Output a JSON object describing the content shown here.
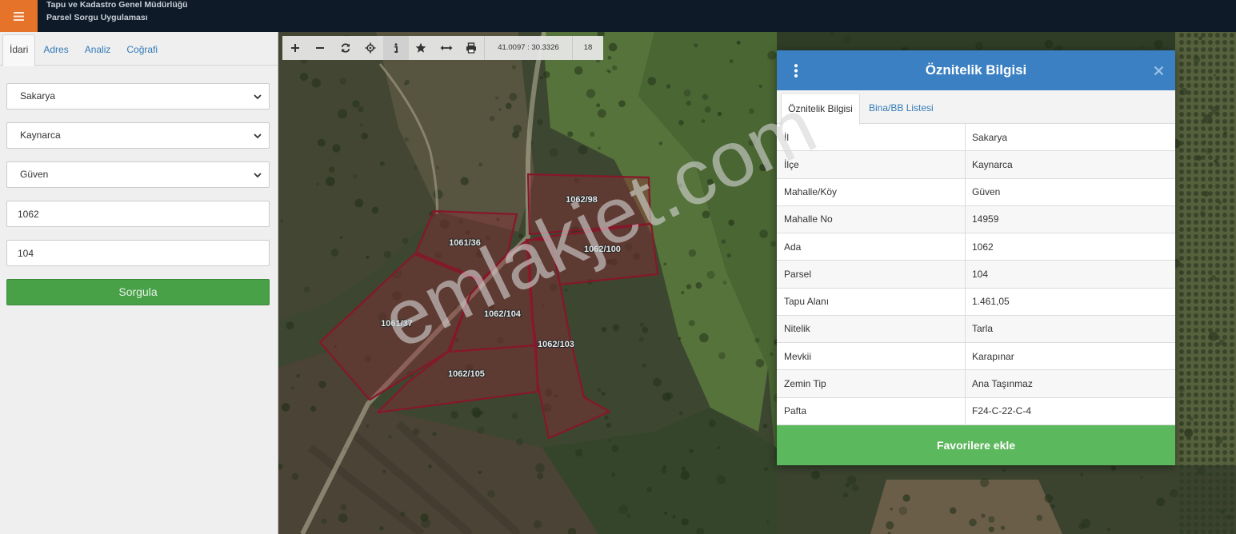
{
  "header": {
    "title_line1": "Tapu ve Kadastro Genel Müdürlüğü",
    "title_line2": "Parsel Sorgu Uygulaması",
    "menu_icon": "hamburger-icon"
  },
  "colors": {
    "header_bg": "#0e1a27",
    "menu_button": "#e5732a",
    "link": "#337ab7",
    "submit_button": "#48a047",
    "panel_header": "#3a80c3",
    "favorite_button": "#5cb85c",
    "parcel_outline": "#86172a"
  },
  "sidebar": {
    "tabs": [
      {
        "label": "İdari",
        "active": true
      },
      {
        "label": "Adres",
        "active": false
      },
      {
        "label": "Analiz",
        "active": false
      },
      {
        "label": "Coğrafi",
        "active": false
      }
    ],
    "form": {
      "province": "Sakarya",
      "district": "Kaynarca",
      "neighborhood": "Güven",
      "ada": "1062",
      "parsel": "104",
      "submit_label": "Sorgula"
    }
  },
  "map": {
    "toolbar": {
      "buttons": [
        "zoom-in-icon",
        "zoom-out-icon",
        "refresh-icon",
        "locate-icon",
        "info-icon",
        "star-icon",
        "measure-icon",
        "print-icon"
      ],
      "active_button": "info-icon",
      "coordinates": "41.0097 : 30.3326",
      "zoom": "18"
    },
    "parcels": [
      "1062/98",
      "1062/100",
      "1062/103",
      "1061/36",
      "1061/37",
      "1062/104",
      "1062/105"
    ],
    "watermark": "emlakjet.com"
  },
  "panel": {
    "title": "Öznitelik Bilgisi",
    "tabs": [
      {
        "label": "Öznitelik Bilgisi",
        "active": true
      },
      {
        "label": "Bina/BB Listesi",
        "active": false
      }
    ],
    "rows": [
      {
        "key": "İl",
        "value": "Sakarya"
      },
      {
        "key": "İlçe",
        "value": "Kaynarca"
      },
      {
        "key": "Mahalle/Köy",
        "value": "Güven"
      },
      {
        "key": "Mahalle No",
        "value": "14959"
      },
      {
        "key": "Ada",
        "value": "1062"
      },
      {
        "key": "Parsel",
        "value": "104"
      },
      {
        "key": "Tapu Alanı",
        "value": "1.461,05"
      },
      {
        "key": "Nitelik",
        "value": "Tarla"
      },
      {
        "key": "Mevkii",
        "value": "Karapınar"
      },
      {
        "key": "Zemin Tip",
        "value": "Ana Taşınmaz"
      },
      {
        "key": "Pafta",
        "value": "F24-C-22-C-4"
      }
    ],
    "favorite_label": "Favorilere ekle"
  }
}
